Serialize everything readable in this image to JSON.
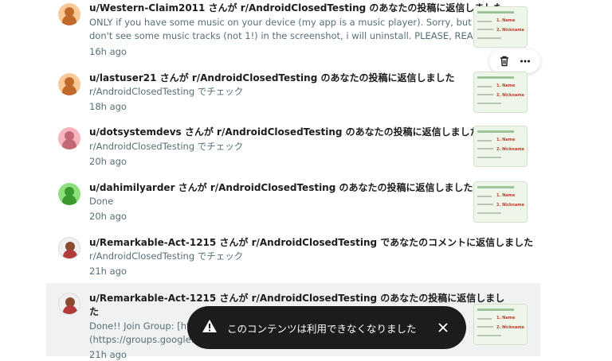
{
  "notifications": [
    {
      "user": "u/Western-Claim2011",
      "title": "u/Western-Claim2011 さんが r/AndroidClosedTesting のあなたの投稿に返信しました",
      "line1": "ONLY if you have some music on your device (my app is a music player). Sorry, but if i",
      "line2": "don't see some music tracks (not 1!) in the screenshot, i will uninstall. PLEASE, READ...",
      "time": "16h ago",
      "avatar_color": "#f4a261"
    },
    {
      "user": "u/lastuser21",
      "title": "u/lastuser21 さんが r/AndroidClosedTesting のあなたの投稿に返信しました",
      "line1": "r/AndroidClosedTesting でチェック",
      "time": "18h ago",
      "avatar_color": "#f4a261"
    },
    {
      "user": "u/dotsystemdevs",
      "title": "u/dotsystemdevs さんが r/AndroidClosedTesting のあなたの投稿に返信しました",
      "line1": "r/AndroidClosedTesting でチェック",
      "time": "20h ago",
      "avatar_color": "#f28b9a"
    },
    {
      "user": "u/dahimilyarder",
      "title": "u/dahimilyarder さんが r/AndroidClosedTesting のあなたの投稿に返信しました",
      "line1": "Done",
      "time": "20h ago",
      "avatar_color": "#5cc84e"
    },
    {
      "user": "u/Remarkable-Act-1215",
      "title": "u/Remarkable-Act-1215 さんが r/AndroidClosedTesting であなたのコメントに返信しました",
      "line1": "r/AndroidClosedTesting でチェック",
      "time": "21h ago",
      "avatar_color": "#e8e8e8"
    },
    {
      "user": "u/Remarkable-Act-1215",
      "title": "u/Remarkable-Act-1215 さんが r/AndroidClosedTesting のあなたの投稿に返信しまし",
      "title2": "た",
      "line1": "Done!! Join Group: [htt",
      "line2": "(https://groups.google.c",
      "time": "21h ago",
      "avatar_color": "#e8e8e8"
    }
  ],
  "thumb_labels": {
    "name": "1. Name",
    "nickname": "2. Nickname"
  },
  "actions": {
    "delete_icon": "trash-icon",
    "more_icon": "more-icon"
  },
  "toast": {
    "message": "このコンテンツは利用できなくなりました",
    "icon": "warning-icon"
  }
}
